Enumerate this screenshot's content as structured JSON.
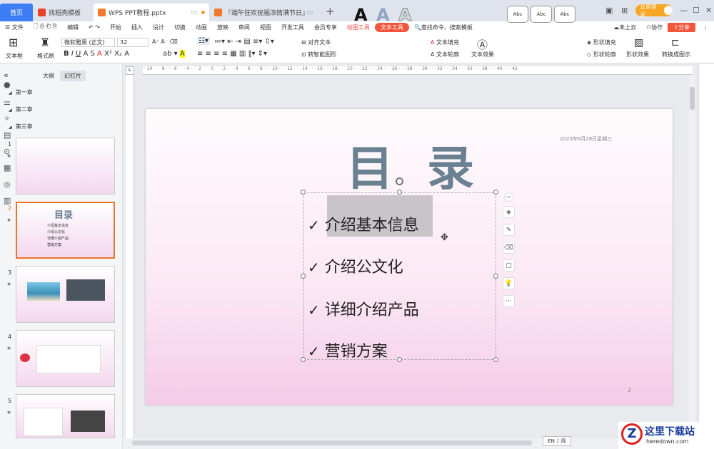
{
  "tabs": {
    "home": "首页",
    "template": "找稻壳模板",
    "doc": "WPS PPT教程.pptx",
    "other": "『端午狂欢祝福浓情满节日』"
  },
  "login": "立即登录",
  "menu": {
    "file": "文件",
    "edit": "编辑",
    "items": [
      "开始",
      "插入",
      "设计",
      "切换",
      "动画",
      "放映",
      "审阅",
      "视图",
      "开发工具",
      "会员专享"
    ],
    "draw_tools": "绘图工具",
    "text_tools": "文本工具",
    "search_placeholder": "查找命令、搜索模板",
    "cloud": "未上云",
    "collab": "协作",
    "share": "分享"
  },
  "ribbon": {
    "textbox": "文本框",
    "format_painter": "格式刷",
    "font": "微软雅黑 (正文)",
    "size": "32",
    "align_text": "对齐文本",
    "smart_shape": "转智能图形",
    "text_fill": "文本填充",
    "text_outline": "文本轮廓",
    "text_effect": "文本效果",
    "style_abc": "Abc",
    "shape_fill": "形状填充",
    "shape_outline": "形状轮廓",
    "shape_effect": "形状效果",
    "convert": "转换成图示"
  },
  "panel": {
    "outline_tab": "大纲",
    "slides_tab": "幻灯片",
    "chapters": [
      "第一章",
      "第二章",
      "第三章"
    ],
    "slide_numbers": [
      "1",
      "2",
      "3",
      "4",
      "5"
    ],
    "thumb2_title": "目录",
    "thumb2_items": [
      "介绍基本信息",
      "介绍公文化",
      "详细介绍产品",
      "营销方案"
    ]
  },
  "slide": {
    "title": "目 录",
    "date": "2023年6月28日星期三",
    "bullets": [
      "介绍基本信息",
      "介绍公文化",
      "详细介绍产品",
      "营销方案"
    ],
    "check": "✓",
    "number": "2"
  },
  "status": {
    "ime": "EN ♪ 简"
  },
  "watermark": {
    "logo": "Z",
    "name": "这里下载站",
    "url": "heredown.com"
  }
}
